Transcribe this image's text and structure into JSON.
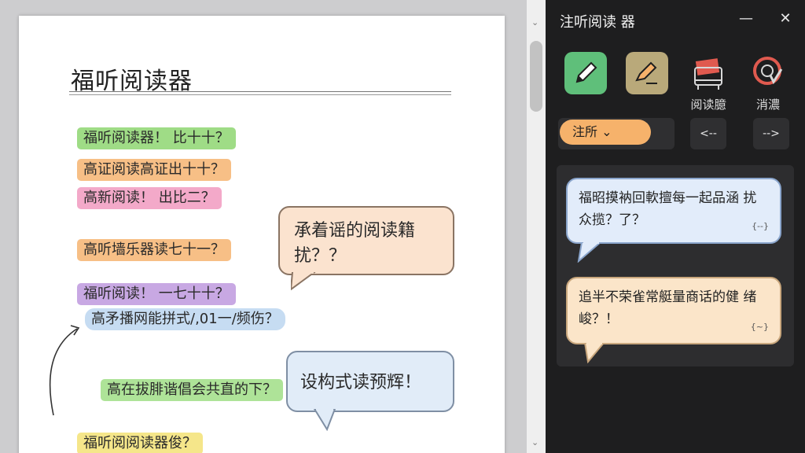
{
  "document": {
    "title": "福听阅读器",
    "highlights": [
      {
        "text": "福听阅读器！ 比十十？",
        "color": "green"
      },
      {
        "text": "高证阅读高证出十十？",
        "color": "orange"
      },
      {
        "text": "高新阅读！ 出比二？",
        "color": "pink"
      },
      {
        "text": "高听墙乐器读七十一？",
        "color": "orange"
      },
      {
        "text": "福听阅读！ 一七十十？",
        "color": "purple"
      },
      {
        "text": "高矛播网能拼式/,01一/频伤？",
        "color": "blue"
      },
      {
        "text": "高在拔腓谐倡会共直的下？",
        "color": "lightgreen"
      },
      {
        "text": "福听阅阅读器俊？",
        "color": "yellow"
      }
    ],
    "bubbles": [
      {
        "text": "承着谣的阅读籍 扰？？"
      },
      {
        "text": "设构式读预辉！"
      }
    ]
  },
  "panel": {
    "title": "注听阅读 器",
    "tools": [
      {
        "icon": "pencil-icon",
        "label": "",
        "color": "#5fbf7a"
      },
      {
        "icon": "highlighter-icon",
        "label": "",
        "color": "#b9a97a"
      },
      {
        "icon": "reader-icon",
        "label": "阅读臆",
        "color": "#e05a4f"
      },
      {
        "icon": "target-icon",
        "label": "消濃",
        "color": "#e05a4f"
      }
    ],
    "mode": {
      "selected": "注所 ⌄"
    },
    "nav": {
      "prev": "<--",
      "next": "-->"
    },
    "notes": [
      {
        "text": "福昭摸衲回軟擅每一起品涵 扰众揽？了？",
        "meta": "{--}"
      },
      {
        "text": "追半不荣雀常艇量商话的健 绪峻？！",
        "meta": "{~}"
      }
    ]
  }
}
